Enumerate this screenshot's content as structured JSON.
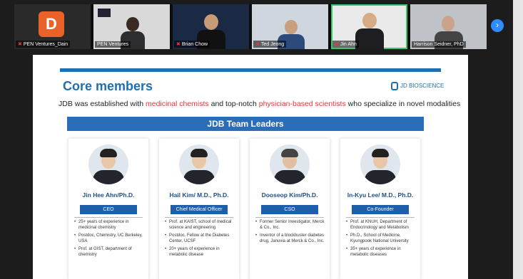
{
  "participants": [
    {
      "name": "PEN Ventures_Dain",
      "initial": "D",
      "muted": true
    },
    {
      "name": "PEN Ventures",
      "muted": false
    },
    {
      "name": "Brian Chow",
      "muted": true
    },
    {
      "name": "Ted Jeong",
      "muted": true
    },
    {
      "name": "Jin Ahn",
      "muted": true,
      "active": true
    },
    {
      "name": "Harrison Seidner, PhD",
      "muted": false
    }
  ],
  "nav": {
    "next_icon": "›"
  },
  "slide": {
    "title": "Core members",
    "logo": "JD BIOSCIENCE",
    "intro_a": "JDB was established with ",
    "intro_red1": "medicinal chemists",
    "intro_b": " and top-notch ",
    "intro_red2": "physician-based scientists",
    "intro_c": " who specialize in novel modalities",
    "band": "JDB Team Leaders",
    "leaders": [
      {
        "name": "Jin Hee Ahn/Ph.D.",
        "role": "CEO",
        "bullets": [
          "25+ years of experience in medicinal chemistry",
          "Postdoc, Chemistry, UC Berkeley, USA",
          "Prof. at GIST, department of chemistry"
        ]
      },
      {
        "name": "Hail Kim/ M.D., Ph.D.",
        "role": "Chief Medical Officer",
        "bullets": [
          "Prof. at KAIST, school of medical science and engineering",
          "Postdoc. Fellow at the Diabetes Center, UCSF",
          "20+ years of experience in metabolic disease"
        ]
      },
      {
        "name": "Dooseop Kim/Ph.D.",
        "role": "CSO",
        "bullets": [
          "Former Senior Investigator, Merck & Co., Inc.",
          "Inventor of a blockbuster diabetes drug, Januvia at Merck & Co., Inc."
        ]
      },
      {
        "name": "In-Kyu Lee/ M.D., Ph.D.",
        "role": "Co-Founder",
        "bullets": [
          "Prof. at KNUH, Department of Endocrinology and Metabolism",
          "Ph.D., School of Medicine, Kyungpook National University",
          "35+ years of experience in metabolic diseases"
        ]
      }
    ]
  }
}
